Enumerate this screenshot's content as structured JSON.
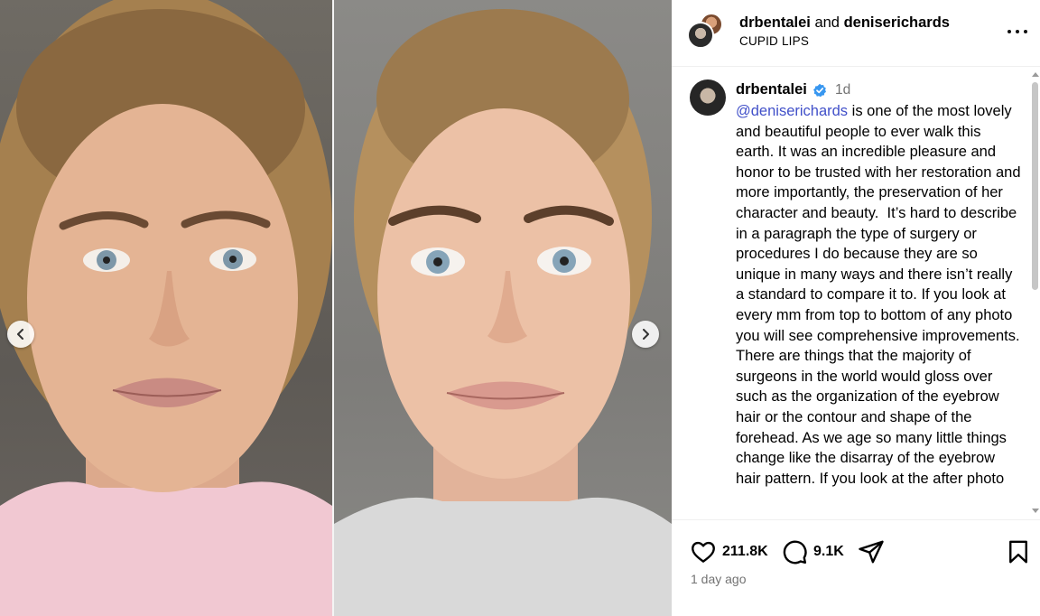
{
  "media": {
    "prev_label": "Previous",
    "next_label": "Next"
  },
  "header": {
    "user1": "drbentalei",
    "joiner": " and ",
    "user2": "deniserichards",
    "subtitle": "CUPID LIPS",
    "more_icon": "more-horizontal-icon"
  },
  "caption": {
    "username": "drbentalei",
    "verified_icon": "verified-badge-icon",
    "time": "1d",
    "mention": "@deniserichards",
    "text": " is one of the most lovely and beautiful people to ever walk this earth. It was an incredible pleasure and honor to be trusted with her restoration and more importantly, the preservation of her character and beauty.  It’s hard to describe in a paragraph the type of surgery or procedures I do because they are so unique in many ways and there isn’t really a standard to compare it to. If you look at every mm from top to bottom of any photo you will see comprehensive improvements.  There are things that the majority of surgeons in the world would gloss over such as the organization of the eyebrow hair or the contour and shape of the forehead. As we age so many little things change like the disarray of the eyebrow hair pattern. If you look at the after photo"
  },
  "actions": {
    "likes": "211.8K",
    "comments": "9.1K",
    "like_icon": "heart-icon",
    "comment_icon": "comment-bubble-icon",
    "share_icon": "paper-plane-icon",
    "save_icon": "bookmark-icon"
  },
  "timestamp": "1 day ago"
}
